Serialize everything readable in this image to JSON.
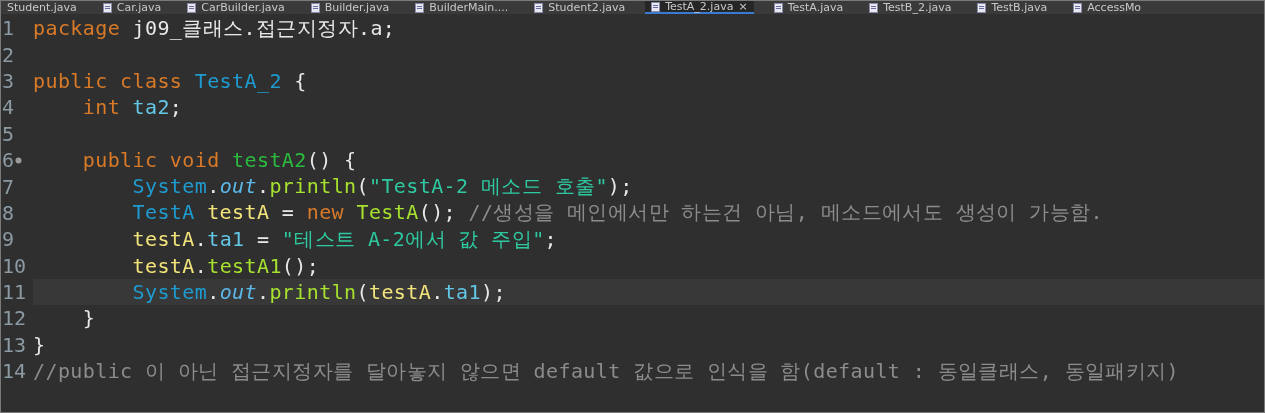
{
  "tabs": [
    {
      "label": "Student.java",
      "selected": false,
      "icon": false
    },
    {
      "label": "Car.java",
      "selected": false,
      "icon": true
    },
    {
      "label": "CarBuilder.java",
      "selected": false,
      "icon": true
    },
    {
      "label": "Builder.java",
      "selected": false,
      "icon": true
    },
    {
      "label": "BuilderMain....",
      "selected": false,
      "icon": true
    },
    {
      "label": "Student2.java",
      "selected": false,
      "icon": true
    },
    {
      "label": "TestA_2.java",
      "selected": true,
      "icon": true,
      "close": "×"
    },
    {
      "label": "TestA.java",
      "selected": false,
      "icon": true
    },
    {
      "label": "TestB_2.java",
      "selected": false,
      "icon": true
    },
    {
      "label": "TestB.java",
      "selected": false,
      "icon": true
    },
    {
      "label": "AccessMo",
      "selected": false,
      "icon": true
    }
  ],
  "editor": {
    "lines": [
      {
        "number": "1",
        "current": false,
        "marker": false,
        "tokens": [
          {
            "kind": "keyword",
            "text": "package"
          },
          {
            "kind": "plain",
            "text": " j09_클래스.접근지정자.a;"
          }
        ]
      },
      {
        "number": "2",
        "current": false,
        "marker": false
      },
      {
        "number": "3",
        "current": false,
        "marker": false,
        "tokens": [
          {
            "kind": "keyword",
            "text": "public class "
          },
          {
            "kind": "type",
            "text": "TestA_2"
          },
          {
            "kind": "plain",
            "text": " {"
          }
        ]
      },
      {
        "number": "4",
        "current": false,
        "marker": false,
        "tokens": [
          {
            "kind": "keyword",
            "text": "    int "
          },
          {
            "kind": "field",
            "text": "ta2"
          },
          {
            "kind": "plain",
            "text": ";"
          }
        ]
      },
      {
        "number": "5",
        "current": false,
        "marker": false
      },
      {
        "number": "6",
        "current": false,
        "marker": true,
        "tokens": [
          {
            "kind": "keyword",
            "text": "    public void "
          },
          {
            "kind": "method",
            "text": "testA2"
          },
          {
            "kind": "plain",
            "text": "() {"
          }
        ]
      },
      {
        "number": "7",
        "current": false,
        "marker": false,
        "tokens": [
          {
            "kind": "type",
            "text": "        System"
          },
          {
            "kind": "plain",
            "text": "."
          },
          {
            "kind": "static",
            "text": "out"
          },
          {
            "kind": "plain",
            "text": "."
          },
          {
            "kind": "call",
            "text": "println"
          },
          {
            "kind": "plain",
            "text": "("
          },
          {
            "kind": "string",
            "text": "\"TestA-2 메소드 호출\""
          },
          {
            "kind": "plain",
            "text": ");"
          }
        ]
      },
      {
        "number": "8",
        "current": false,
        "marker": false,
        "tokens": [
          {
            "kind": "type",
            "text": "        TestA"
          },
          {
            "kind": "local",
            "text": " testA"
          },
          {
            "kind": "plain",
            "text": " = "
          },
          {
            "kind": "keyword",
            "text": "new "
          },
          {
            "kind": "call",
            "text": "TestA"
          },
          {
            "kind": "plain",
            "text": "(); "
          },
          {
            "kind": "comment",
            "text": "//생성을 메인에서만 하는건 아님, 메소드에서도 생성이 가능함."
          }
        ]
      },
      {
        "number": "9",
        "current": false,
        "marker": false,
        "tokens": [
          {
            "kind": "local",
            "text": "        testA"
          },
          {
            "kind": "plain",
            "text": "."
          },
          {
            "kind": "field",
            "text": "ta1"
          },
          {
            "kind": "plain",
            "text": " = "
          },
          {
            "kind": "string",
            "text": "\"테스트 A-2에서 값 주입\""
          },
          {
            "kind": "plain",
            "text": ";"
          }
        ]
      },
      {
        "number": "10",
        "current": false,
        "marker": false,
        "tokens": [
          {
            "kind": "local",
            "text": "        testA"
          },
          {
            "kind": "plain",
            "text": "."
          },
          {
            "kind": "call",
            "text": "testA1"
          },
          {
            "kind": "plain",
            "text": "();"
          }
        ]
      },
      {
        "number": "11",
        "current": true,
        "marker": false,
        "tokens": [
          {
            "kind": "type",
            "text": "        System"
          },
          {
            "kind": "plain",
            "text": "."
          },
          {
            "kind": "static",
            "text": "out"
          },
          {
            "kind": "plain",
            "text": "."
          },
          {
            "kind": "call",
            "text": "println"
          },
          {
            "kind": "plain",
            "text": "("
          },
          {
            "kind": "local",
            "text": "testA"
          },
          {
            "kind": "plain",
            "text": "."
          },
          {
            "kind": "field",
            "text": "ta1"
          },
          {
            "kind": "plain",
            "text": ");"
          }
        ]
      },
      {
        "number": "12",
        "current": false,
        "marker": false,
        "tokens": [
          {
            "kind": "plain",
            "text": "    }"
          }
        ]
      },
      {
        "number": "13",
        "current": false,
        "marker": false,
        "tokens": [
          {
            "kind": "plain",
            "text": "}"
          }
        ]
      },
      {
        "number": "14",
        "current": false,
        "marker": false,
        "tokens": [
          {
            "kind": "comment",
            "text": "//public 이 아닌 접근지정자를 달아놓지 않으면 default 값으로 인식을 함(default : 동일클래스, 동일패키지)"
          }
        ]
      }
    ]
  }
}
